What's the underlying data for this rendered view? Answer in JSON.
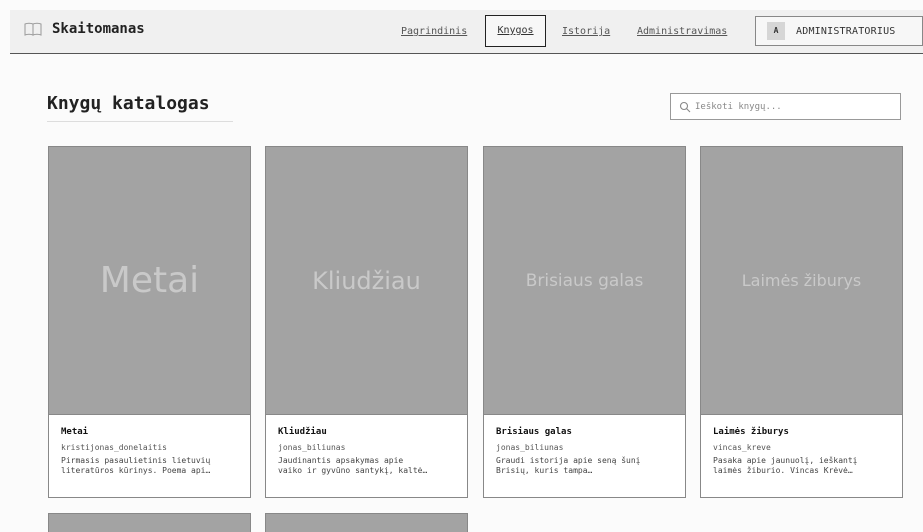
{
  "brand": {
    "name": "Skaitomanas",
    "icon": "book-open-icon"
  },
  "nav": {
    "home": "Pagrindinis",
    "books": "Knygos",
    "history": "Istorija",
    "admin": "Administravimas"
  },
  "user": {
    "avatar_initial": "A",
    "role_label": "ADMINISTRATORIUS"
  },
  "main": {
    "title": "Knygų katalogas",
    "search_placeholder": "Ieškoti knygų..."
  },
  "books": [
    {
      "cover_text": "Metai",
      "title": "Metai",
      "author": "kristijonas_donelaitis",
      "desc_line1": "Pirmasis pasaulietinis lietuvių",
      "desc_line2": "literatūros kūrinys. Poema api…"
    },
    {
      "cover_text": "Kliudžiau",
      "title": "Kliudžiau",
      "author": "jonas_biliunas",
      "desc_line1": "Jaudinantis apsakymas apie",
      "desc_line2": "vaiko ir gyvūno santykį, kaltė…"
    },
    {
      "cover_text": "Brisiaus galas",
      "title": "Brisiaus galas",
      "author": "jonas_biliunas",
      "desc_line1": "Graudi istorija apie seną šunį",
      "desc_line2": "Brisių, kuris tampa…"
    },
    {
      "cover_text": "Laimės žiburys",
      "title": "Laimės žiburys",
      "author": "vincas_kreve",
      "desc_line1": "Pasaka apie jaunuolį, ieškantį",
      "desc_line2": "laimės žiburio. Vincas Krėvė…"
    }
  ],
  "colors": {
    "cover_bg": "#a3a3a3",
    "cover_text": "#c9c9c9",
    "nav_border": "#222222"
  }
}
